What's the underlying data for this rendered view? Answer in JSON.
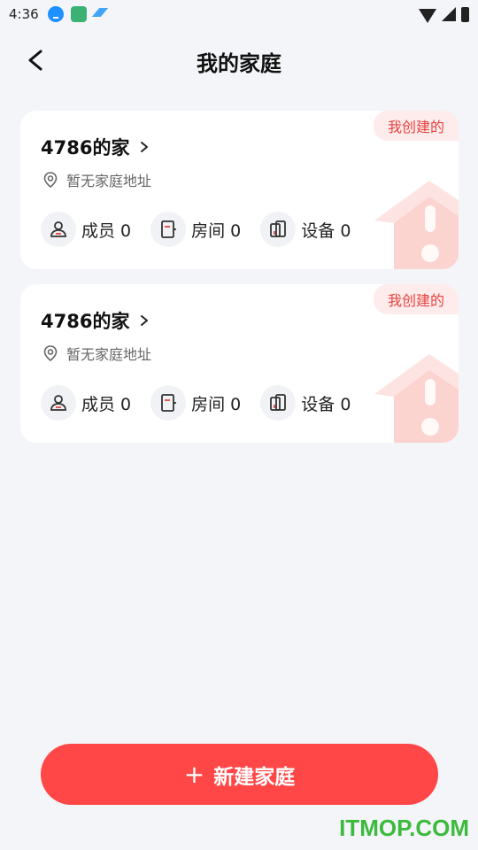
{
  "status_bar": {
    "time": "4:36"
  },
  "header": {
    "title": "我的家庭"
  },
  "homes": [
    {
      "name": "4786的家",
      "badge": "我创建的",
      "address": "暂无家庭地址",
      "stats": {
        "members": "成员 0",
        "rooms": "房间 0",
        "devices": "设备 0"
      }
    },
    {
      "name": "4786的家",
      "badge": "我创建的",
      "address": "暂无家庭地址",
      "stats": {
        "members": "成员 0",
        "rooms": "房间 0",
        "devices": "设备 0"
      }
    }
  ],
  "actions": {
    "new_home": "新建家庭",
    "new_home_plus": "+"
  },
  "watermark": "ITMOP.COM",
  "colors": {
    "accent": "#ff4747",
    "badge_text": "#e8423f",
    "badge_bg": "#fdeceb",
    "page_bg": "#f3f5f8"
  }
}
